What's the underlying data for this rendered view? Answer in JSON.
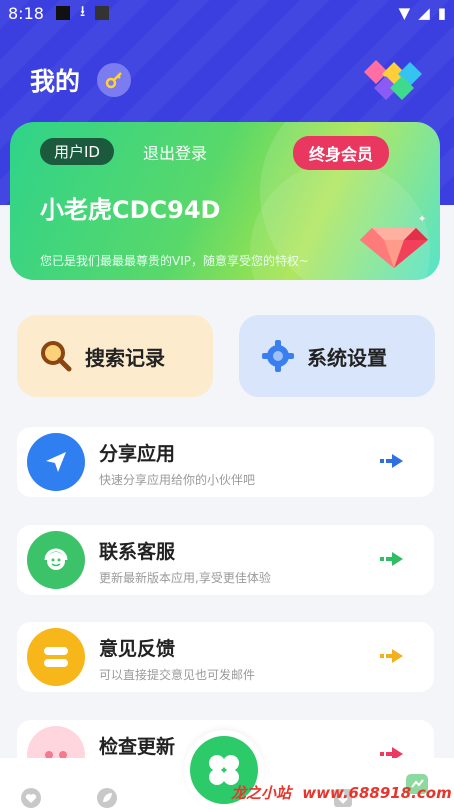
{
  "status_bar": {
    "time": "8:18"
  },
  "header": {
    "title": "我的"
  },
  "vip_card": {
    "uid_label": "用户ID",
    "logout_label": "退出登录",
    "member_label": "终身会员",
    "username": "小老虎CDC94D",
    "vip_message": "您已是我们最最最尊贵的VIP，随意享受您的特权~"
  },
  "quick_actions": [
    {
      "label": "搜索记录",
      "icon": "search-icon"
    },
    {
      "label": "系统设置",
      "icon": "gear-icon"
    }
  ],
  "menu": [
    {
      "title": "分享应用",
      "subtitle": "快速分享应用给你的小伙伴吧",
      "icon": "paper-plane-icon",
      "color": "#2f7ff0",
      "arrow_color": "#2f6fe4"
    },
    {
      "title": "联系客服",
      "subtitle": "更新最新版本应用,享受更佳体验",
      "icon": "headset-icon",
      "color": "#3cc36a",
      "arrow_color": "#2ebf64"
    },
    {
      "title": "意见反馈",
      "subtitle": "可以直接提交意见也可发邮件",
      "icon": "feedback-icon",
      "color": "#f7b619",
      "arrow_color": "#f2b01c"
    },
    {
      "title": "检查更新",
      "subtitle": "",
      "icon": "update-icon",
      "color": "#ffd6dd",
      "arrow_color": "#ee3a63"
    }
  ],
  "watermark": {
    "brand": "龙之小站",
    "url": "www.688918.com"
  }
}
